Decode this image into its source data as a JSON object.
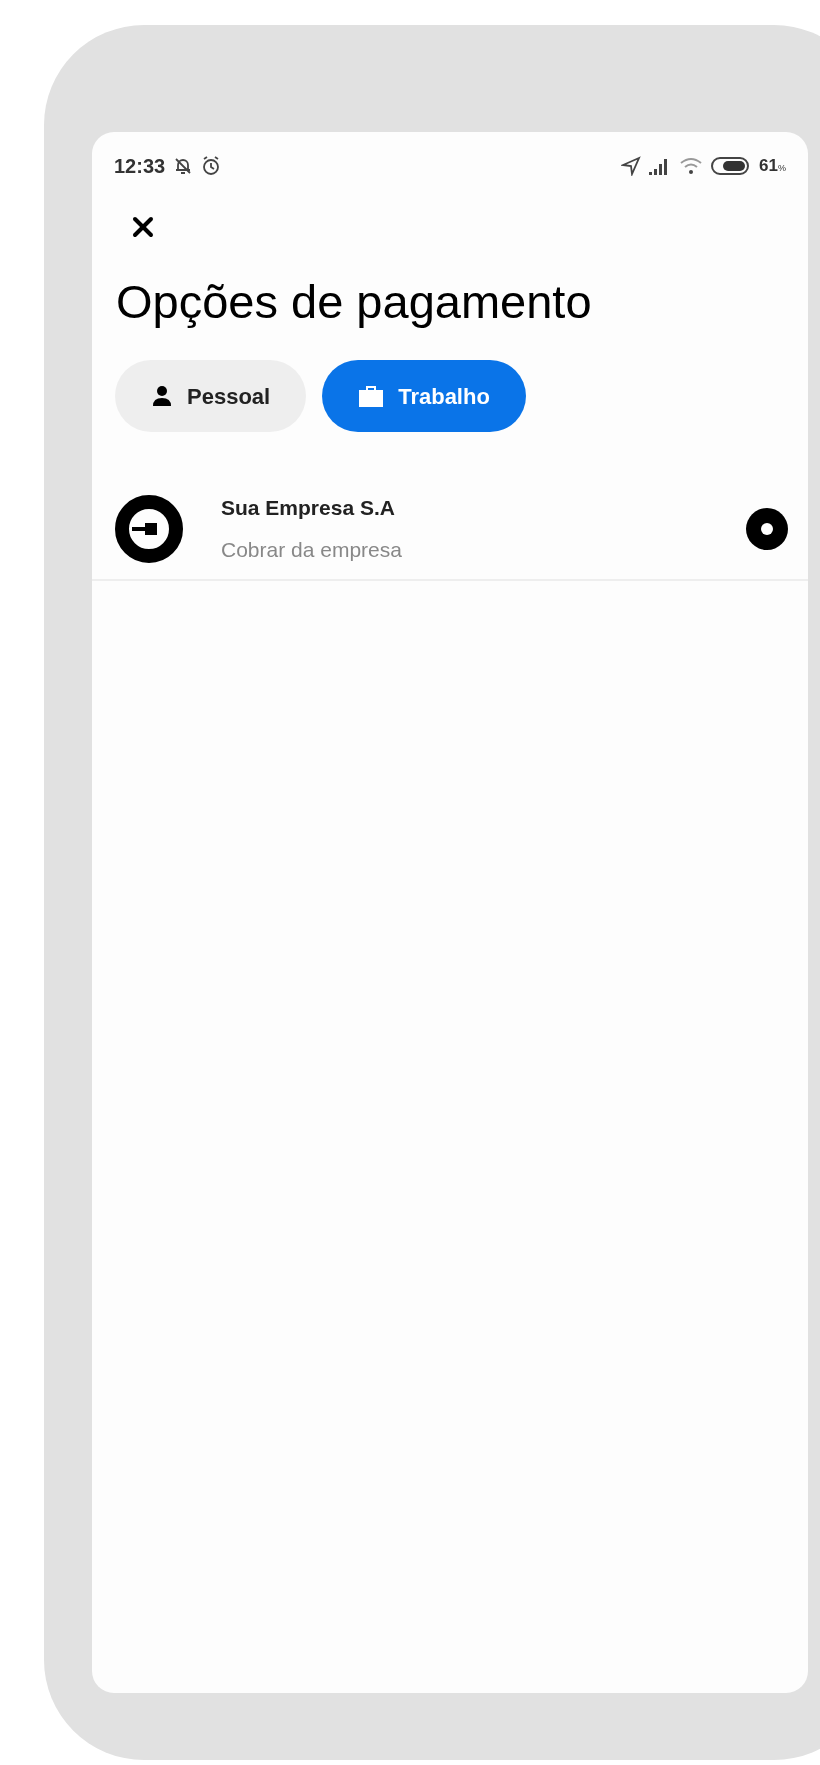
{
  "status_bar": {
    "time": "12:33",
    "battery": "61",
    "battery_unit": "%"
  },
  "title": "Opções de pagamento",
  "tabs": [
    {
      "label": "Pessoal",
      "kind": "person",
      "selected": false
    },
    {
      "label": "Trabalho",
      "kind": "briefcase",
      "selected": true
    }
  ],
  "payment_options": [
    {
      "name": "Sua Empresa S.A",
      "description": "Cobrar da empresa",
      "selected": true
    }
  ]
}
